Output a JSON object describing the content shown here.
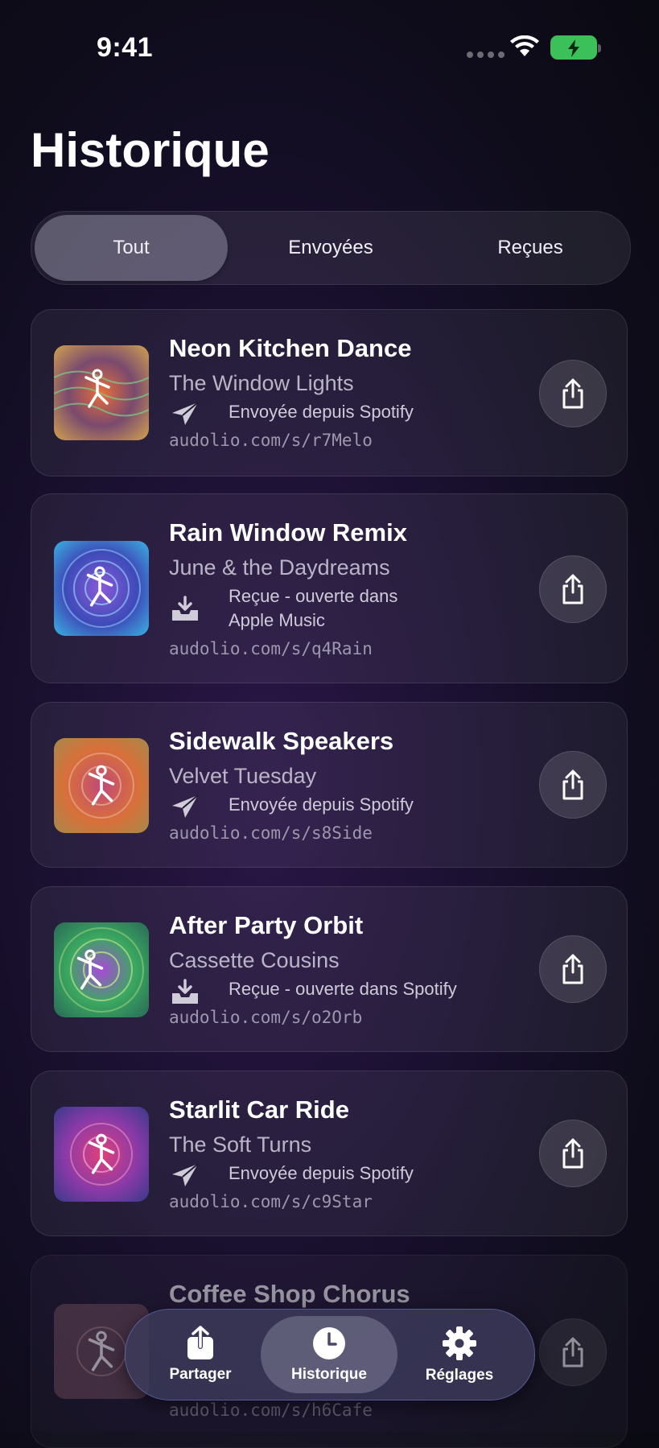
{
  "status": {
    "time": "9:41"
  },
  "page": {
    "title": "Historique"
  },
  "segments": [
    "Tout",
    "Envoyées",
    "Reçues"
  ],
  "items": [
    {
      "song": "Neon Kitchen Dance",
      "artist": "The Window Lights",
      "status_icon": "paper-plane-icon",
      "status": "Envoyée depuis Spotify",
      "link": "audolio.com/s/r7Melo"
    },
    {
      "song": "Rain Window Remix",
      "artist": "June & the Daydreams",
      "status_icon": "inbox-download-icon",
      "status_line1": "Reçue - ouverte dans",
      "status_line2": "Apple Music",
      "link": "audolio.com/s/q4Rain"
    },
    {
      "song": "Sidewalk Speakers",
      "artist": "Velvet Tuesday",
      "status_icon": "paper-plane-icon",
      "status": "Envoyée depuis Spotify",
      "link": "audolio.com/s/s8Side"
    },
    {
      "song": "After Party Orbit",
      "artist": "Cassette Cousins",
      "status_icon": "inbox-download-icon",
      "status": "Reçue - ouverte dans Spotify",
      "link": "audolio.com/s/o2Orb"
    },
    {
      "song": "Starlit Car Ride",
      "artist": "The Soft Turns",
      "status_icon": "paper-plane-icon",
      "status": "Envoyée depuis Spotify",
      "link": "audolio.com/s/c9Star"
    },
    {
      "song": "Coffee Shop Chorus",
      "link": "audolio.com/s/h6Cafe"
    }
  ],
  "tabbar": {
    "tabs": [
      {
        "label": "Partager",
        "icon": "share-icon"
      },
      {
        "label": "Historique",
        "icon": "clock-icon",
        "active": true
      },
      {
        "label": "Réglages",
        "icon": "gear-icon"
      }
    ]
  },
  "colors": {
    "battery": "#3cc15a",
    "background": "#1a1030"
  }
}
